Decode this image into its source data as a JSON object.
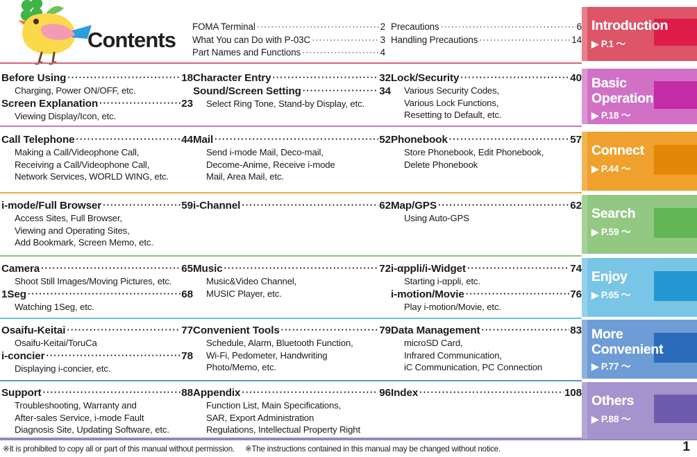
{
  "page_title": "Contents",
  "mascot": {
    "name": "yellow-bird-with-clover",
    "body_color": "#fcd94b",
    "wing_color": "#f59ab5",
    "tail_color": "#2a9fdc",
    "beak_color": "#f07c2a",
    "clover_color": "#3fb449",
    "leg_color": "#6b4a2a",
    "eye_color": "#4a2d18"
  },
  "header_entries": {
    "left": [
      {
        "title": "FOMA Terminal",
        "page": "2"
      },
      {
        "title": "What You can Do with P-03C",
        "page": "3"
      },
      {
        "title": "Part Names and Functions",
        "page": "4"
      }
    ],
    "right": [
      {
        "title": "Precautions",
        "page": "6"
      },
      {
        "title": "Handling Precautions",
        "page": "14"
      }
    ]
  },
  "rows": [
    {
      "id": "basic-operation",
      "divider_color": "#d9637a",
      "columns": [
        {
          "entries": [
            {
              "title": "Before Using",
              "page": "18",
              "sub": [
                "Charging, Power ON/OFF, etc."
              ]
            },
            {
              "title": "Screen Explanation",
              "page": "23",
              "sub": [
                "Viewing Display/Icon, etc."
              ]
            }
          ]
        },
        {
          "entries": [
            {
              "title": "Character Entry",
              "page": "32",
              "sub": []
            },
            {
              "title": "Sound/Screen Setting",
              "page": "34",
              "sub": [
                "Select Ring Tone, Stand-by Display, etc."
              ]
            }
          ]
        },
        {
          "entries": [
            {
              "title": "Lock/Security",
              "page": "40",
              "sub": [
                "Various Security Codes,",
                "Various Lock Functions,",
                "Resetting to Default, etc."
              ]
            }
          ]
        }
      ]
    },
    {
      "id": "connect",
      "divider_color": "#c878bd",
      "columns": [
        {
          "entries": [
            {
              "title": "Call Telephone",
              "page": "44",
              "sub": [
                "Making a Call/Videophone Call,",
                "Receiving a Call/Videophone Call,",
                "Network Services, WORLD WING, etc."
              ]
            }
          ]
        },
        {
          "entries": [
            {
              "title": "Mail",
              "page": "52",
              "sub": [
                "Send i-mode Mail, Deco-mail,",
                "Decome-Anime, Receive i-mode",
                "Mail, Area Mail, etc."
              ]
            }
          ]
        },
        {
          "entries": [
            {
              "title": "Phonebook",
              "page": "57",
              "sub": [
                "Store Phonebook, Edit Phonebook,",
                "Delete Phonebook"
              ]
            }
          ]
        }
      ]
    },
    {
      "id": "search",
      "divider_color": "#eaa83c",
      "columns": [
        {
          "entries": [
            {
              "title": "i-mode/Full Browser",
              "page": "59",
              "sub": [
                "Access Sites, Full Browser,",
                "Viewing and Operating Sites,",
                "Add Bookmark, Screen Memo, etc."
              ]
            }
          ]
        },
        {
          "entries": [
            {
              "title": "i-Channel",
              "page": "62",
              "sub": []
            }
          ]
        },
        {
          "entries": [
            {
              "title": "Map/GPS",
              "page": "62",
              "sub": [
                "Using Auto-GPS"
              ]
            }
          ]
        }
      ]
    },
    {
      "id": "enjoy",
      "divider_color": "#8cc474",
      "columns": [
        {
          "entries": [
            {
              "title": "Camera",
              "page": "65",
              "sub": [
                "Shoot Still Images/Moving Pictures, etc."
              ]
            },
            {
              "title": "1Seg",
              "page": "68",
              "sub": [
                "Watching 1Seg, etc."
              ]
            }
          ]
        },
        {
          "entries": [
            {
              "title": "Music",
              "page": "72",
              "sub": [
                "Music&Video Channel,",
                "MUSIC Player, etc."
              ]
            }
          ]
        },
        {
          "entries": [
            {
              "title": "i-αppli/i-Widget",
              "page": "74",
              "sub": [
                "Starting i-αppli, etc."
              ]
            },
            {
              "title": "i-motion/Movie",
              "page": "76",
              "sub": [
                "Play i-motion/Movie, etc."
              ]
            }
          ]
        }
      ]
    },
    {
      "id": "more-convenient",
      "divider_color": "#6cc0e0",
      "columns": [
        {
          "entries": [
            {
              "title": "Osaifu-Keitai",
              "page": "77",
              "sub": [
                "Osaifu-Keitai/ToruCa"
              ]
            },
            {
              "title": "i-concier",
              "page": "78",
              "sub": [
                "Displaying i-concier, etc."
              ]
            }
          ]
        },
        {
          "entries": [
            {
              "title": "Convenient Tools",
              "page": "79",
              "sub": [
                "Schedule, Alarm, Bluetooth Function,",
                "Wi-Fi, Pedometer, Handwriting",
                "Photo/Memo, etc."
              ]
            }
          ]
        },
        {
          "entries": [
            {
              "title": "Data Management",
              "page": "83",
              "sub": [
                "microSD Card,",
                "Infrared Communication,",
                "iC Communication, PC Connection"
              ]
            }
          ]
        }
      ]
    },
    {
      "id": "others",
      "divider_color": "#5f93d1",
      "columns": [
        {
          "entries": [
            {
              "title": "Support",
              "page": "88",
              "sub": [
                "Troubleshooting, Warranty and",
                "After-sales Service, i-mode Fault",
                "Diagnosis Site, Updating Software, etc."
              ]
            }
          ]
        },
        {
          "entries": [
            {
              "title": "Appendix",
              "page": "96",
              "sub": [
                "Function List, Main Specifications,",
                "SAR, Export Administration",
                "Regulations, Intellectual Property Right"
              ]
            }
          ]
        },
        {
          "entries": [
            {
              "title": "Index",
              "page": "108",
              "sub": []
            }
          ]
        }
      ]
    }
  ],
  "tabs": [
    {
      "label": "Introduction",
      "page_label": "▶ P.1 〜",
      "bg": "#dd5566",
      "block": "#dd1c4a",
      "strip": "#f0a3a8"
    },
    {
      "label": "Basic Operation",
      "page_label": "▶ P.18 〜",
      "bg": "#d171c6",
      "block": "#c42ba6",
      "strip": "#e3b7dd"
    },
    {
      "label": "Connect",
      "page_label": "▶ P.44 〜",
      "bg": "#f0a02c",
      "block": "#e48708",
      "strip": "#f3c477"
    },
    {
      "label": "Search",
      "page_label": "▶ P.59 〜",
      "bg": "#92c882",
      "block": "#62b655",
      "strip": "#b6d9a8"
    },
    {
      "label": "Enjoy",
      "page_label": "▶ P.65 〜",
      "bg": "#79c5e5",
      "block": "#2496d2",
      "strip": "#a9d9ec"
    },
    {
      "label": "More Convenient",
      "page_label": "▶ P.77 〜",
      "bg": "#6d9cd6",
      "block": "#2b6cba",
      "strip": "#a8c3e4"
    },
    {
      "label": "Others",
      "page_label": "▶ P.88 〜",
      "bg": "#a593cd",
      "block": "#6d5cae",
      "strip": "#c2b4dd"
    }
  ],
  "footer": {
    "note_left": "※It is prohibited to copy all or part of this manual without permission.",
    "note_right": "※The instructions contained in this manual may be changed without notice.",
    "page_number": "1"
  }
}
